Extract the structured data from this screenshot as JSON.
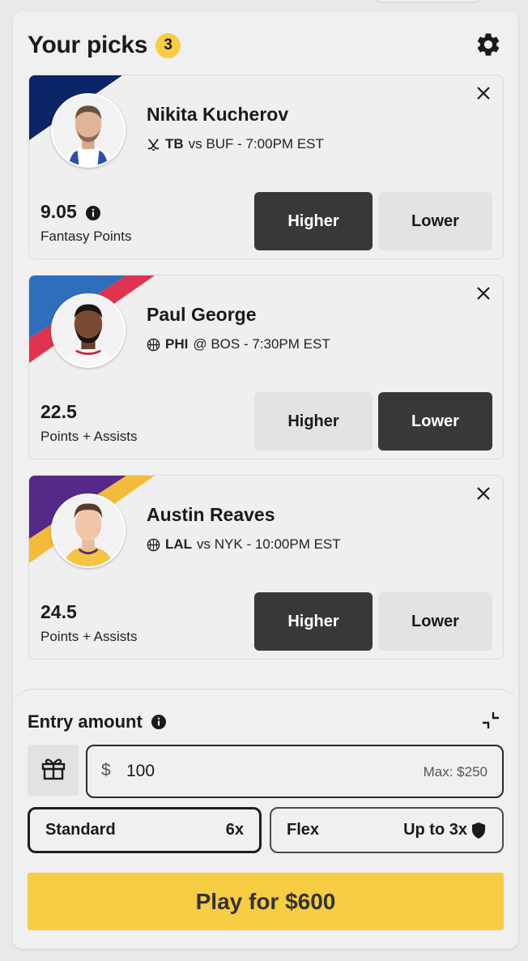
{
  "header": {
    "title": "Your picks",
    "count": "3"
  },
  "picks": [
    {
      "name": "Nikita Kucherov",
      "sport_icon": "hockey-sticks-icon",
      "team": "TB",
      "matchup_rest": "vs BUF - 7:00PM EST",
      "stat_value": "9.05",
      "stat_label": "Fantasy Points",
      "higher_label": "Higher",
      "lower_label": "Lower",
      "selected": "higher",
      "team_colors": [
        "#0b2566",
        "#ffffff"
      ]
    },
    {
      "name": "Paul George",
      "sport_icon": "basketball-icon",
      "team": "PHI",
      "matchup_rest": "@ BOS - 7:30PM EST",
      "stat_value": "22.5",
      "stat_label": "Points + Assists",
      "higher_label": "Higher",
      "lower_label": "Lower",
      "selected": "lower",
      "team_colors": [
        "#2e6ebd",
        "#e0334f"
      ]
    },
    {
      "name": "Austin Reaves",
      "sport_icon": "basketball-icon",
      "team": "LAL",
      "matchup_rest": "vs NYK - 10:00PM EST",
      "stat_value": "24.5",
      "stat_label": "Points + Assists",
      "higher_label": "Higher",
      "lower_label": "Lower",
      "selected": "higher",
      "team_colors": [
        "#55288a",
        "#f4bb3a"
      ]
    }
  ],
  "entry": {
    "title": "Entry amount",
    "currency": "$",
    "amount": "100",
    "max": "Max: $250",
    "standard_label": "Standard",
    "standard_multiplier": "6x",
    "flex_label": "Flex",
    "flex_multiplier": "Up to 3x",
    "selected_mode": "standard",
    "play_label": "Play for $600"
  },
  "colors": {
    "accent": "#f6cd43",
    "selected_button": "#383838",
    "unselected_button": "#e3e3e3"
  }
}
